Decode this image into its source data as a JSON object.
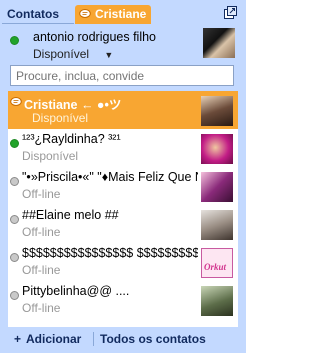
{
  "tabs": {
    "contacts": "Contatos",
    "chat": "Cristiane"
  },
  "self": {
    "name": "antonio rodrigues filho",
    "status": "Disponível",
    "status_caret": "▼"
  },
  "search": {
    "placeholder": "Procure, inclua, convide"
  },
  "contacts": [
    {
      "name": "Cristiane ← ●•ツ",
      "sub": "Disponível",
      "state": "chat",
      "avatar_color": "#6b4b3a"
    },
    {
      "name": "¹²³¿Rayldinha? ³²¹",
      "sub": "Disponível",
      "state": "online",
      "avatar_color": "#c21d86"
    },
    {
      "name": "\"•»Priscila•«\" \"♦Mais Feliz Que N",
      "sub": "Off-line",
      "state": "offline",
      "avatar_color": "#8a2a7a"
    },
    {
      "name": "##Elaine melo ##",
      "sub": "Off-line",
      "state": "offline",
      "avatar_color": "#9b8f85"
    },
    {
      "name": "$$$$$$$$$$$$$$$$ $$$$$$$$$$$$$",
      "sub": "Off-line",
      "state": "offline",
      "avatar_color": "#c85aa0"
    },
    {
      "name": "Pittybelinha@@ ....",
      "sub": "Off-line",
      "state": "offline",
      "avatar_color": "#5d6e4a"
    }
  ],
  "orkut_label": "Orkut",
  "footer": {
    "add_plus": "+",
    "add_label": "Adicionar",
    "all_label": "Todos os contatos"
  },
  "colors": {
    "accent": "#f8a632",
    "panel": "#c3d9ff",
    "online": "#21a32a",
    "offline": "#c9c9c9"
  }
}
